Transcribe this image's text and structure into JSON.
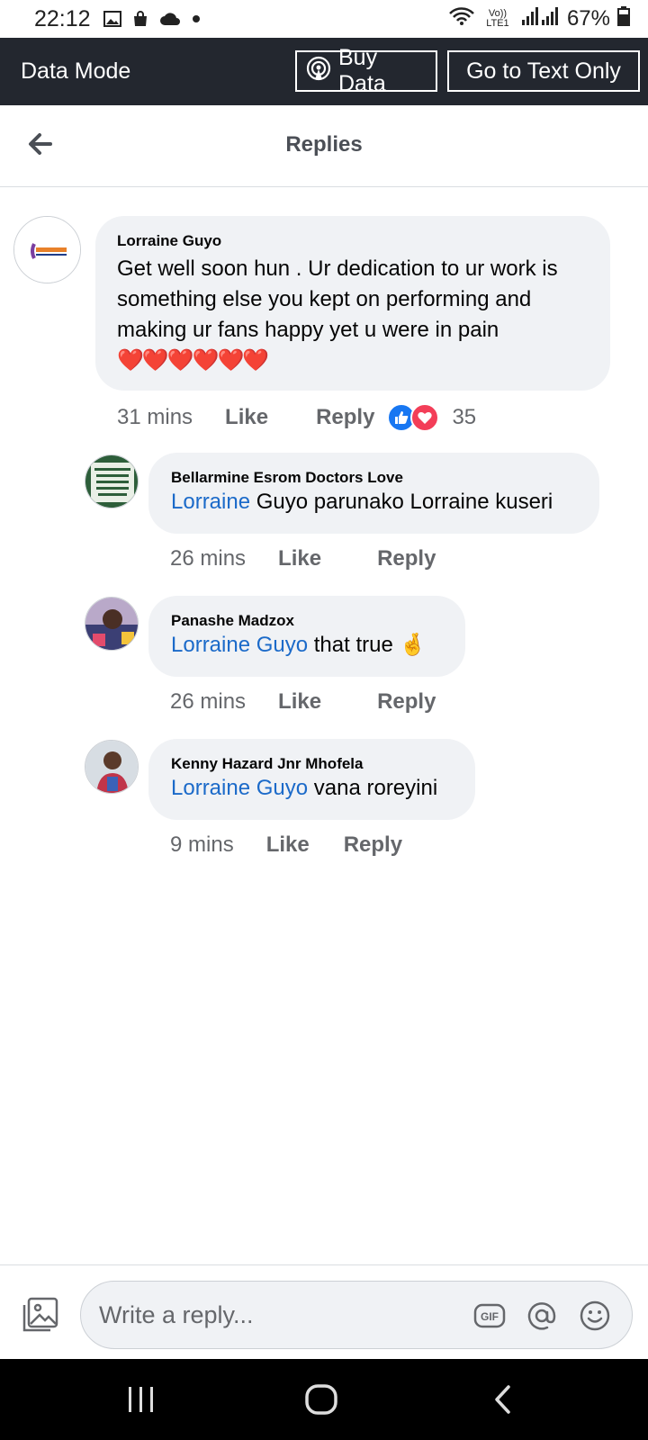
{
  "status_bar": {
    "time": "22:12",
    "network": "Vo)) LTE1",
    "battery": "67%"
  },
  "data_bar": {
    "title": "Data Mode",
    "buy_label": "Buy Data",
    "text_only_label": "Go to Text Only"
  },
  "header": {
    "title": "Replies"
  },
  "comment": {
    "author": "Lorraine Guyo",
    "text": "Get well soon hun . Ur dedication to ur work is something else you kept on performing and making ur fans happy yet u were in pain",
    "emoji": "❤️❤️❤️❤️❤️❤️",
    "time": "31 mins",
    "like_label": "Like",
    "reply_label": "Reply",
    "reaction_count": "35",
    "reactions": [
      "like-icon",
      "love-icon"
    ]
  },
  "replies": [
    {
      "author": "Bellarmine Esrom Doctors Love",
      "mention": "Lorraine",
      "text": " Guyo parunako Lorraine kuseri",
      "time": "26 mins",
      "like_label": "Like",
      "reply_label": "Reply"
    },
    {
      "author": "Panashe Madzox",
      "mention": "Lorraine Guyo",
      "text": " that true 🤞",
      "time": "26 mins",
      "like_label": "Like",
      "reply_label": "Reply"
    },
    {
      "author": "Kenny Hazard Jnr Mhofela",
      "mention": "Lorraine Guyo",
      "text": " vana roreyini",
      "time": "9 mins",
      "like_label": "Like",
      "reply_label": "Reply"
    }
  ],
  "composer": {
    "placeholder": "Write a reply...",
    "gif_label": "GIF"
  },
  "colors": {
    "mention": "#1b6ac9",
    "data_bar_bg": "#23272f",
    "bubble_bg": "#f0f2f5"
  }
}
